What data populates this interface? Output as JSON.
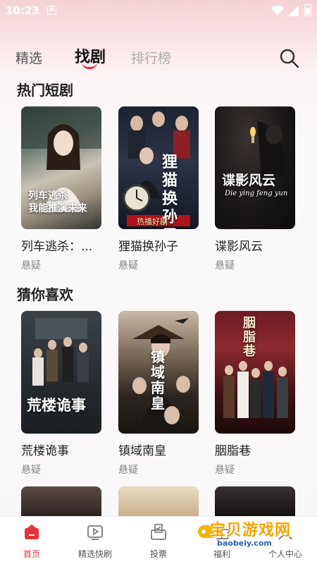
{
  "status": {
    "time": "10:23",
    "icon_a": "A"
  },
  "tabs": [
    {
      "label": "精选"
    },
    {
      "label": "找剧"
    },
    {
      "label": "排行榜"
    }
  ],
  "sections": {
    "hot": {
      "title": "热门短剧",
      "cards": [
        {
          "title": "列车逃杀：...",
          "tag": "悬疑",
          "poster_text": "列车逃杀\n我能推演未来",
          "poster_sub": ""
        },
        {
          "title": "狸猫换孙子",
          "tag": "悬疑",
          "poster_text": "狸猫换孙子",
          "poster_sub": "热播好剧"
        },
        {
          "title": "谍影风云",
          "tag": "悬疑",
          "poster_text": "谍影风云",
          "poster_sub": "Die ying feng yun"
        }
      ]
    },
    "guess": {
      "title": "猜你喜欢",
      "cards": [
        {
          "title": "荒楼诡事",
          "tag": "悬疑",
          "poster_text": "荒楼诡事"
        },
        {
          "title": "镇域南皇",
          "tag": "悬疑",
          "poster_text": "镇域南皇"
        },
        {
          "title": "胭脂巷",
          "tag": "悬疑",
          "poster_text": "胭脂巷"
        }
      ]
    }
  },
  "bottom_nav": [
    {
      "label": "首页",
      "icon": "home-icon",
      "active": true
    },
    {
      "label": "精选快刷",
      "icon": "play-screen-icon"
    },
    {
      "label": "投票",
      "icon": "vote-icon"
    },
    {
      "label": "福利",
      "icon": "gift-icon"
    },
    {
      "label": "个人中心",
      "icon": "user-icon"
    }
  ],
  "watermark": {
    "text": "宝贝游戏网",
    "url": "baobeiy.com"
  },
  "colors": {
    "accent": "#e8323a",
    "header_tint": "#f6d2d6"
  }
}
